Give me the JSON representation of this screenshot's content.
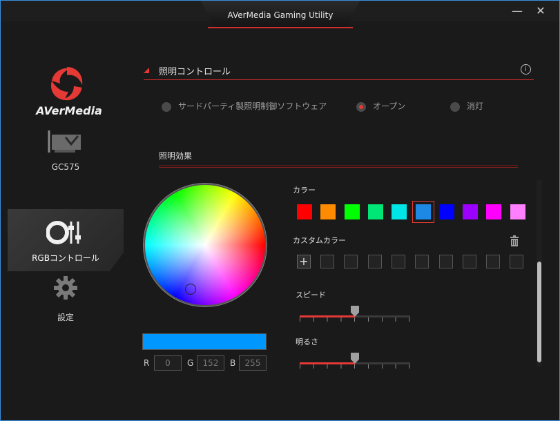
{
  "window": {
    "title": "AVerMedia Gaming Utility",
    "minimize": "—",
    "close": "✕"
  },
  "sidebar": {
    "brand": "AVerMedia",
    "items": [
      {
        "label": "GC575",
        "icon": "capture-card-icon"
      },
      {
        "label": "RGBコントロール",
        "icon": "rgb-control-icon",
        "active": true
      },
      {
        "label": "設定",
        "icon": "gear-icon"
      }
    ]
  },
  "lighting": {
    "title": "照明コントロール",
    "modes": [
      {
        "label": "サードパーティ製照明制御ソフトウェア",
        "selected": false
      },
      {
        "label": "オープン",
        "selected": true
      },
      {
        "label": "消灯",
        "selected": false
      }
    ]
  },
  "effects": {
    "title": "照明効果",
    "color_label": "カラー",
    "colors": [
      "#ff0000",
      "#ff8c00",
      "#00ff00",
      "#00e676",
      "#00e5e5",
      "#1e88e5",
      "#0000ff",
      "#9c00ff",
      "#ff00ff",
      "#ff80ff"
    ],
    "selected_color_index": 5,
    "custom_color_label": "カスタムカラー",
    "custom_slots": 9,
    "speed_label": "スピード",
    "speed_value": 0.5,
    "brightness_label": "明るさ",
    "brightness_value": 0.5,
    "preview_color": "#0098ff",
    "rgb": {
      "r_label": "R",
      "r": "0",
      "g_label": "G",
      "g": "152",
      "b_label": "B",
      "b": "255"
    }
  }
}
